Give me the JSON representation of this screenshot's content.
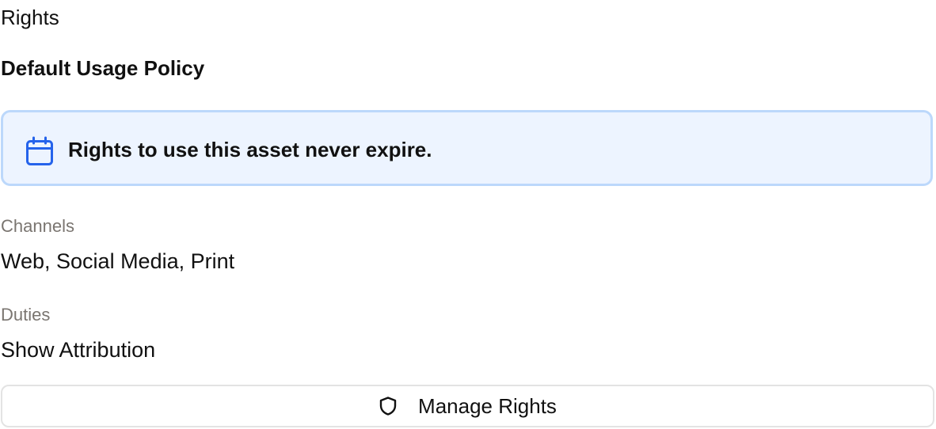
{
  "section": {
    "title": "Rights"
  },
  "policy": {
    "title": "Default Usage Policy",
    "notice": {
      "icon": "calendar-icon",
      "text": "Rights to use this asset never expire.",
      "background_color": "#edf4ff",
      "border_color": "#bcd8fb",
      "icon_color": "#2563eb"
    }
  },
  "fields": {
    "channels": {
      "label": "Channels",
      "value": "Web, Social Media, Print"
    },
    "duties": {
      "label": "Duties",
      "value": "Show Attribution"
    }
  },
  "actions": {
    "manage_rights": {
      "icon": "shield-icon",
      "label": "Manage Rights"
    }
  }
}
